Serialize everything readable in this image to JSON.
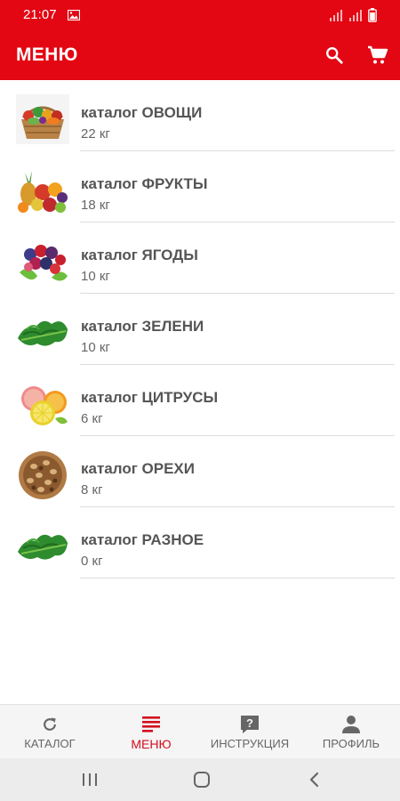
{
  "status_bar": {
    "time": "21:07",
    "icons": [
      "image-icon",
      "signal-icon",
      "signal-icon",
      "battery-icon"
    ]
  },
  "app_bar": {
    "title": "МЕНЮ",
    "actions": [
      "search-icon",
      "cart-icon"
    ],
    "color": "#e30613"
  },
  "catalog": {
    "items": [
      {
        "title": "каталог ОВОЩИ",
        "weight": "22 кг",
        "icon": "vegetables-basket-image"
      },
      {
        "title": "каталог ФРУКТЫ",
        "weight": "18 кг",
        "icon": "fruits-image"
      },
      {
        "title": "каталог ЯГОДЫ",
        "weight": "10 кг",
        "icon": "berries-image"
      },
      {
        "title": "каталог ЗЕЛЕНИ",
        "weight": "10 кг",
        "icon": "greens-image"
      },
      {
        "title": "каталог ЦИТРУСЫ",
        "weight": "6 кг",
        "icon": "citrus-image"
      },
      {
        "title": "каталог ОРЕХИ",
        "weight": "8 кг",
        "icon": "nuts-image"
      },
      {
        "title": "каталог РАЗНОЕ",
        "weight": "0 кг",
        "icon": "greens-image"
      }
    ]
  },
  "bottom_nav": {
    "items": [
      {
        "label": "КАТАЛОГ",
        "icon": "refresh-icon"
      },
      {
        "label": "МЕНЮ",
        "icon": "menu-icon",
        "active": true
      },
      {
        "label": "ИНСТРУКЦИЯ",
        "icon": "help-icon"
      },
      {
        "label": "ПРОФИЛЬ",
        "icon": "person-icon"
      }
    ],
    "active_color": "#d2101d"
  },
  "system_nav": [
    "recents-icon",
    "home-icon",
    "back-icon"
  ]
}
